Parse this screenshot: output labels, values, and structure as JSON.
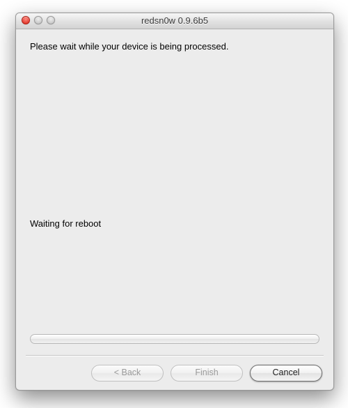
{
  "window": {
    "title": "redsn0w 0.9.6b5"
  },
  "content": {
    "instruction": "Please wait while your device is being processed.",
    "status": "Waiting for reboot"
  },
  "footer": {
    "back_label": "< Back",
    "finish_label": "Finish",
    "cancel_label": "Cancel"
  }
}
